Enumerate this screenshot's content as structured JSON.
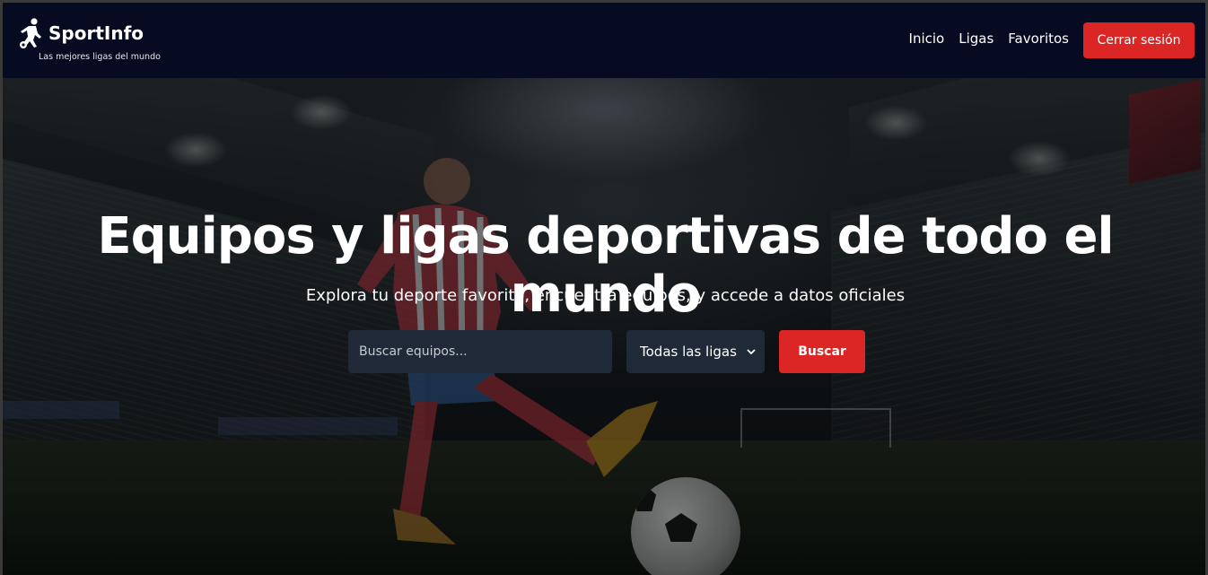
{
  "brand": {
    "name": "SportInfo",
    "tagline": "Las mejores ligas del mundo",
    "logo_icon": "soccer-player-icon"
  },
  "nav": {
    "links": [
      {
        "label": "Inicio"
      },
      {
        "label": "Ligas"
      },
      {
        "label": "Favoritos"
      }
    ],
    "logout_label": "Cerrar sesión"
  },
  "hero": {
    "title": "Equipos y ligas deportivas de todo el mundo",
    "subtitle": "Explora tu deporte favorito, encuentra equipos, y accede a datos oficiales",
    "search": {
      "placeholder": "Buscar equipos...",
      "value": "",
      "league_selected": "Todas las ligas",
      "button_label": "Buscar"
    }
  },
  "colors": {
    "navbar": "#070b22",
    "accent": "#dc2626",
    "input_bg": "#1f2937"
  }
}
